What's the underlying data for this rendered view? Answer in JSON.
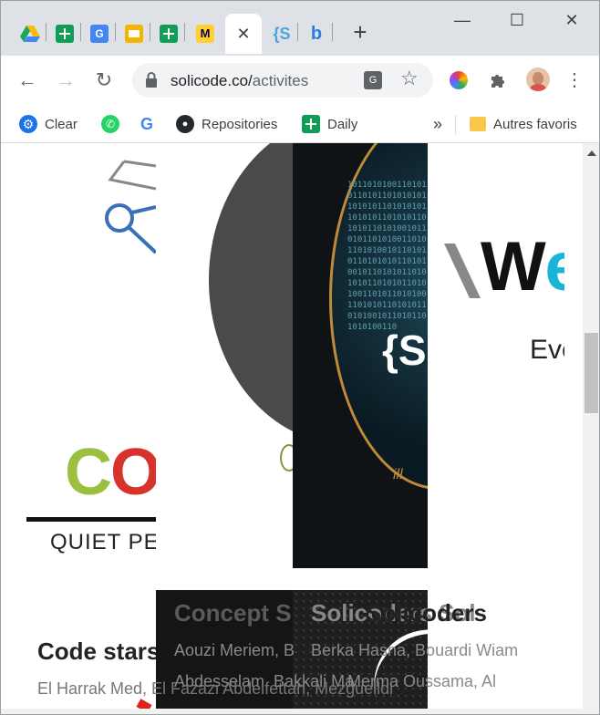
{
  "browser": {
    "tabs": [
      {
        "icon": "google-drive-icon",
        "color": "#1ea362"
      },
      {
        "icon": "google-sheets-icon",
        "color": "#0f9d58"
      },
      {
        "icon": "google-translate-icon",
        "color": "#4285f4"
      },
      {
        "icon": "google-slides-icon",
        "color": "#f4b400"
      },
      {
        "icon": "google-sheets-icon",
        "color": "#0f9d58"
      },
      {
        "icon": "miro-icon",
        "color": "#ffd02f"
      },
      {
        "icon": "close-icon",
        "active": true
      },
      {
        "icon": "solicode-icon",
        "text": "{S",
        "color": "#4ba3e0"
      },
      {
        "icon": "bing-icon",
        "color": "#2a7be4"
      }
    ],
    "url_host": "solicode.co/",
    "url_path": "activites",
    "window_controls": {
      "minimize": "—",
      "maximize": "☐",
      "close": "✕"
    }
  },
  "bookmarks": [
    {
      "icon": "settings-icon",
      "label": "Clear"
    },
    {
      "icon": "whatsapp-icon",
      "label": ""
    },
    {
      "icon": "google-icon",
      "label": ""
    },
    {
      "icon": "github-icon",
      "label": "Repositories"
    },
    {
      "icon": "google-sheets-icon",
      "label": "Daily"
    }
  ],
  "bookmarks_overflow": "»",
  "other_bookmarks": "Autres favoris",
  "page": {
    "left_logo_text": "CO",
    "left_logo_sub": "QUIET PE",
    "right_logo_text": "We",
    "right_logo_sub": "Eve",
    "center_badge": "{S",
    "overlap_title_1": "Concept S",
    "overlap_title_2": "Solicoders Sol",
    "overlap_title_3": "Solicoders",
    "overlap_line_1": "Aouzi Meriem, B",
    "overlap_line_2": "Berka Hasna, Bouardi Wiam",
    "overlap_line_3": "Abdesselam, Bakkali Ma",
    "overlap_line_4": "Merma Oussama, Al",
    "card_title": "Code stars",
    "card_names": "El Harrak Med, El Fazazi Abdelfettah, Mezguelldi"
  }
}
